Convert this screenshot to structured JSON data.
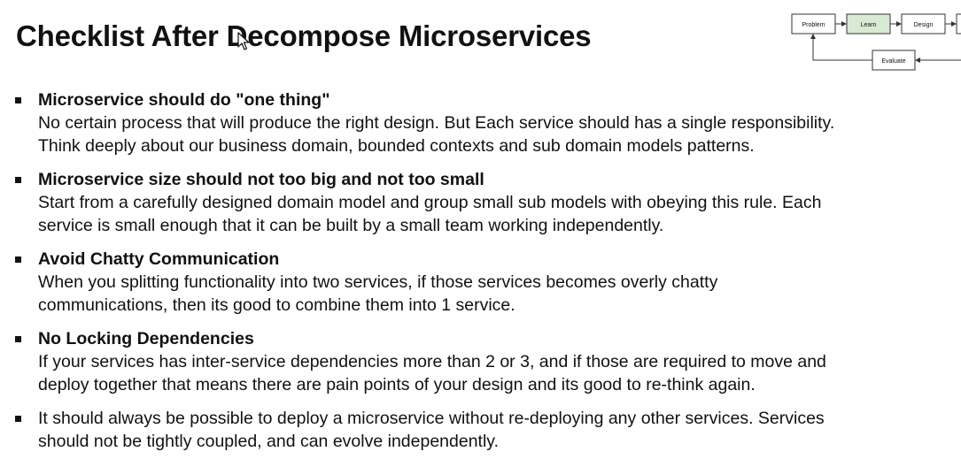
{
  "slide": {
    "title": "Checklist After Decompose Microservices"
  },
  "flow_diagram": {
    "nodes": {
      "problem": "Problem",
      "learn": "Learn",
      "design": "Design",
      "evaluate": "Evaluate"
    },
    "colors": {
      "active_fill": "#d9ead3",
      "border": "#333333"
    }
  },
  "bullets": [
    {
      "heading": "Microservice should do \"one thing\"",
      "lines": [
        "No certain process that will produce the right design. But Each service should has a single responsibility.",
        "Think deeply about our business domain, bounded contexts and sub domain models patterns."
      ]
    },
    {
      "heading": "Microservice size should not too big and not too small",
      "lines": [
        "Start from a carefully designed domain model and group small sub models with obeying this rule. Each",
        "service is small enough that it can be built by a small team working independently."
      ]
    },
    {
      "heading": "Avoid Chatty Communication",
      "lines": [
        "When you splitting functionality into two services, if those services becomes overly chatty",
        "communications, then its good to combine them into 1 service."
      ]
    },
    {
      "heading": "No Locking Dependencies",
      "lines": [
        "If your services has inter-service dependencies more than 2 or 3, and if those are required to move and",
        "deploy together that means there are pain points of your design and its good to re-think again."
      ]
    },
    {
      "heading": "",
      "lines": [
        "It should always be possible to deploy a microservice without re-deploying any other services. Services",
        "should not be tightly coupled, and can evolve independently."
      ]
    }
  ]
}
